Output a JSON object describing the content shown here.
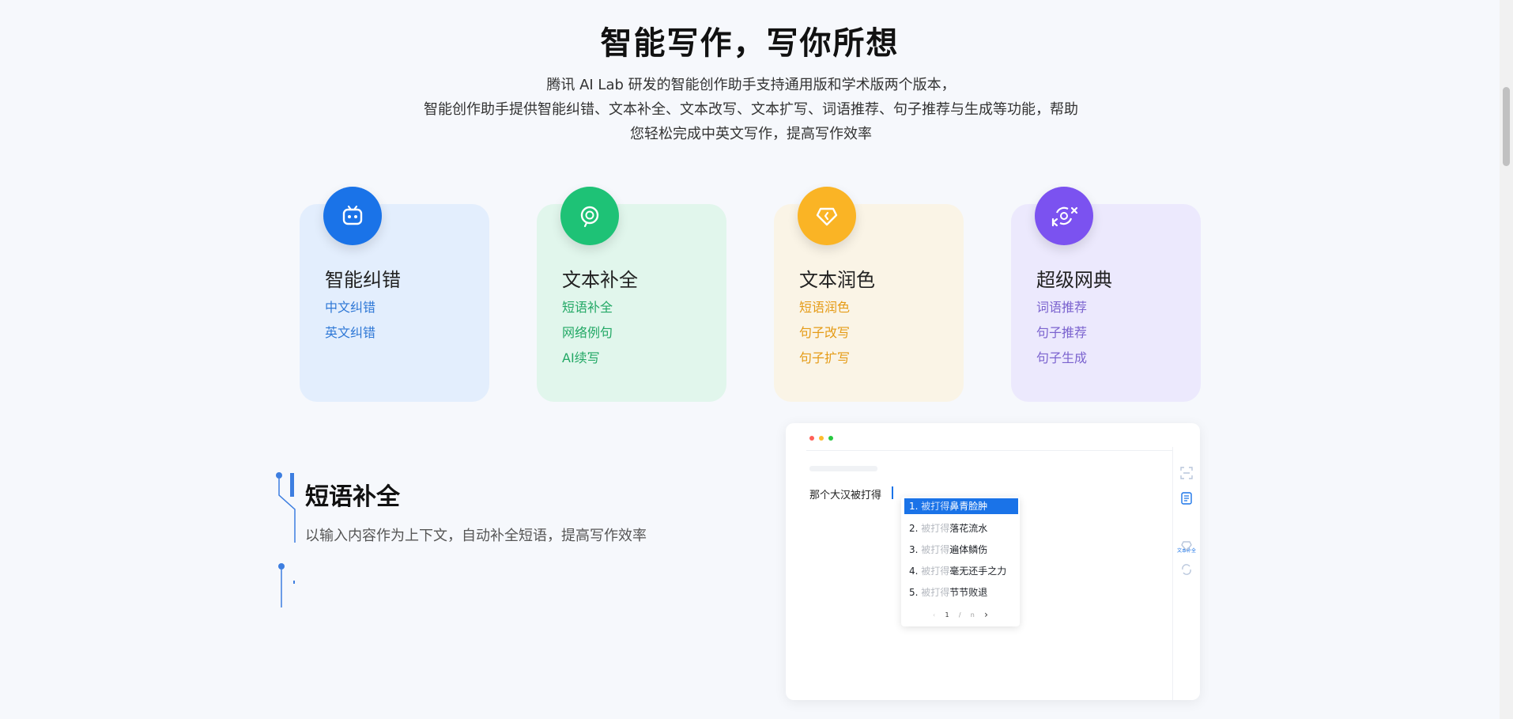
{
  "hero": {
    "title": "智能写作，写你所想",
    "desc_line1": "腾讯 AI Lab 研发的智能创作助手支持通用版和学术版两个版本，",
    "desc_line2": "智能创作助手提供智能纠错、文本补全、文本改写、文本扩写、词语推荐、句子推荐与生成等功能，帮助",
    "desc_line3": "您轻松完成中英文写作，提高写作效率"
  },
  "cards": [
    {
      "title": "智能纠错",
      "links": [
        "中文纠错",
        "英文纠错"
      ],
      "bg": "#e3eefd",
      "icon_color": "#1a73e8",
      "link_color": "#2f78d6",
      "icon": "robot-face-icon"
    },
    {
      "title": "文本补全",
      "links": [
        "短语补全",
        "网络例句",
        "AI续写"
      ],
      "bg": "#e1f6ec",
      "icon_color": "#1ec276",
      "link_color": "#22a865",
      "icon": "speech-bubble-icon"
    },
    {
      "title": "文本润色",
      "links": [
        "短语润色",
        "句子改写",
        "句子扩写"
      ],
      "bg": "#faf4e6",
      "icon_color": "#fab425",
      "link_color": "#e59b16",
      "icon": "tag-icon"
    },
    {
      "title": "超级网典",
      "links": [
        "词语推荐",
        "句子推荐",
        "句子生成"
      ],
      "bg": "#ece9fd",
      "icon_color": "#7b52f0",
      "link_color": "#7b63cf",
      "icon": "translate-icon"
    }
  ],
  "feature": {
    "title": "短语补全",
    "desc": "以输入内容作为上下文，自动补全短语，提高写作效率"
  },
  "demo": {
    "editor_text": "那个大汉被打得",
    "side_label": "文本补全",
    "pager_current": "1",
    "pager_sep": "/",
    "pager_total": "n",
    "suggestions": [
      {
        "num": "1.",
        "prefix": "被打得",
        "text": "鼻青脸肿"
      },
      {
        "num": "2.",
        "prefix": "被打得",
        "text": "落花流水"
      },
      {
        "num": "3.",
        "prefix": "被打得",
        "text": "遍体鳞伤"
      },
      {
        "num": "4.",
        "prefix": "被打得",
        "text": "毫无还手之力"
      },
      {
        "num": "5.",
        "prefix": "被打得",
        "text": "节节败退"
      }
    ]
  },
  "colors": {
    "accent": "#1a73e8",
    "dot_red": "#ff5f57",
    "dot_yellow": "#febc2e",
    "dot_green": "#28c840"
  }
}
